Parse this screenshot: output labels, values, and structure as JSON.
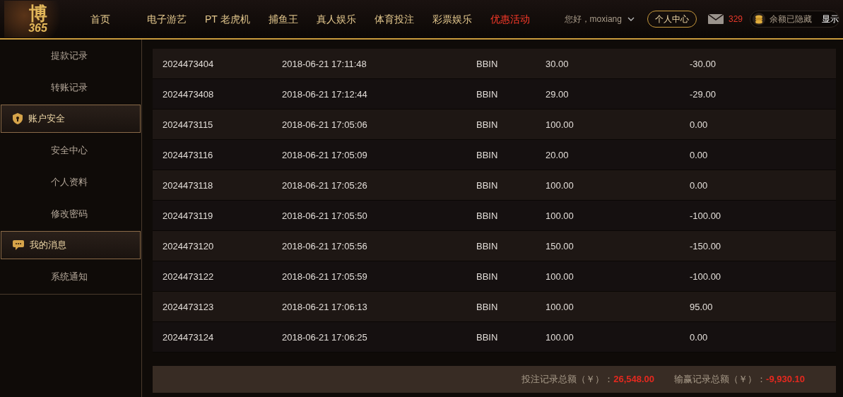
{
  "logo": {
    "glyph": "博",
    "number": "365"
  },
  "nav": [
    {
      "label": "首页",
      "selected": false
    },
    {
      "label": "电子游艺",
      "selected": false
    },
    {
      "label": "PT 老虎机",
      "selected": false
    },
    {
      "label": "捕鱼王",
      "selected": false
    },
    {
      "label": "真人娱乐",
      "selected": false
    },
    {
      "label": "体育投注",
      "selected": false
    },
    {
      "label": "彩票娱乐",
      "selected": false
    },
    {
      "label": "优惠活动",
      "selected": true
    }
  ],
  "user": {
    "greeting": "您好，moxiang",
    "center_button": "个人中心",
    "mail_count": "329",
    "balance": "余额已隐藏",
    "show_button": "显示"
  },
  "sidebar": [
    {
      "kind": "link",
      "label": "提款记录"
    },
    {
      "kind": "link",
      "label": "转账记录"
    },
    {
      "kind": "shield_group",
      "label": "账户安全"
    },
    {
      "kind": "link",
      "label": "安全中心"
    },
    {
      "kind": "link",
      "label": "个人资料"
    },
    {
      "kind": "link",
      "label": "修改密码"
    },
    {
      "kind": "chat_group",
      "label": "我的消息"
    },
    {
      "kind": "link",
      "label": "系统通知"
    }
  ],
  "table": {
    "rows": [
      [
        "2024473404",
        "2018-06-21 17:11:48",
        "BBIN",
        "30.00",
        "-30.00"
      ],
      [
        "2024473408",
        "2018-06-21 17:12:44",
        "BBIN",
        "29.00",
        "-29.00"
      ],
      [
        "2024473115",
        "2018-06-21 17:05:06",
        "BBIN",
        "100.00",
        "0.00"
      ],
      [
        "2024473116",
        "2018-06-21 17:05:09",
        "BBIN",
        "20.00",
        "0.00"
      ],
      [
        "2024473118",
        "2018-06-21 17:05:26",
        "BBIN",
        "100.00",
        "0.00"
      ],
      [
        "2024473119",
        "2018-06-21 17:05:50",
        "BBIN",
        "100.00",
        "-100.00"
      ],
      [
        "2024473120",
        "2018-06-21 17:05:56",
        "BBIN",
        "150.00",
        "-150.00"
      ],
      [
        "2024473122",
        "2018-06-21 17:05:59",
        "BBIN",
        "100.00",
        "-100.00"
      ],
      [
        "2024473123",
        "2018-06-21 17:06:13",
        "BBIN",
        "100.00",
        "95.00"
      ],
      [
        "2024473124",
        "2018-06-21 17:06:25",
        "BBIN",
        "100.00",
        "0.00"
      ]
    ]
  },
  "totals": [
    {
      "label": "投注记录总额（￥）：",
      "value": "26,548.00"
    },
    {
      "label": "输赢记录总额（￥）：",
      "value": "-9,930.10"
    }
  ]
}
